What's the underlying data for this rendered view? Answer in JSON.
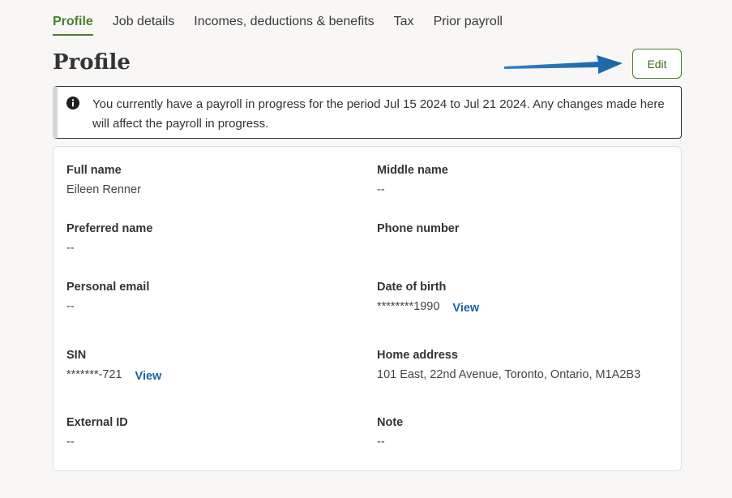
{
  "tabs": [
    {
      "label": "Profile",
      "active": true
    },
    {
      "label": "Job details"
    },
    {
      "label": "Incomes, deductions & benefits"
    },
    {
      "label": "Tax"
    },
    {
      "label": "Prior payroll"
    }
  ],
  "page": {
    "title": "Profile",
    "edit_label": "Edit"
  },
  "alert": {
    "icon": "info-circle-icon",
    "text": "You currently have a payroll in progress for the period Jul 15 2024 to Jul 21 2024. Any changes made here will affect the payroll in progress."
  },
  "fields": {
    "full_name": {
      "label": "Full name",
      "value": "Eileen Renner"
    },
    "middle_name": {
      "label": "Middle name",
      "value": "--"
    },
    "preferred_name": {
      "label": "Preferred name",
      "value": "--"
    },
    "phone_number": {
      "label": "Phone number",
      "value": ""
    },
    "personal_email": {
      "label": "Personal email",
      "value": "--"
    },
    "date_of_birth": {
      "label": "Date of birth",
      "value": "********1990",
      "link": "View"
    },
    "sin": {
      "label": "SIN",
      "value": "*******-721",
      "link": "View"
    },
    "home_address": {
      "label": "Home address",
      "value": "101 East, 22nd Avenue, Toronto, Ontario, M1A2B3"
    },
    "external_id": {
      "label": "External ID",
      "value": "--"
    },
    "note": {
      "label": "Note",
      "value": "--"
    }
  },
  "colors": {
    "accent": "#4d7d2c",
    "link": "#1b64a8",
    "arrow": "#1f6fb8"
  }
}
